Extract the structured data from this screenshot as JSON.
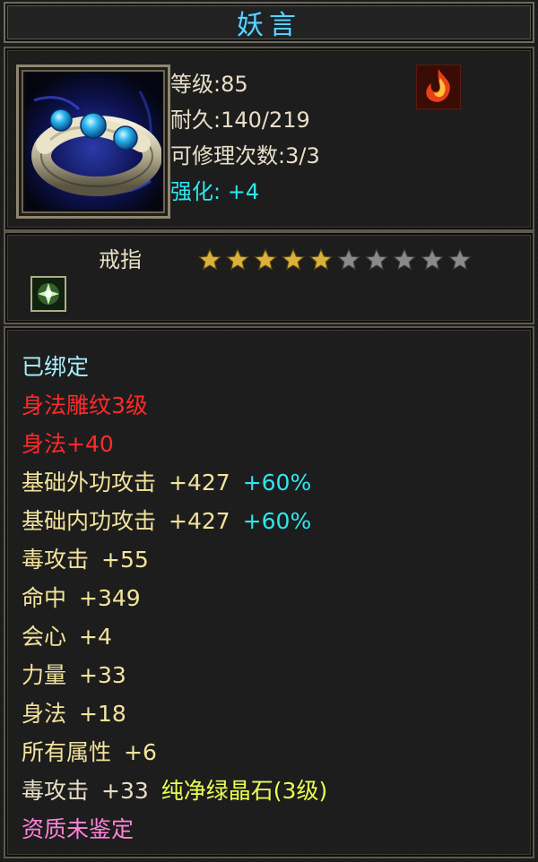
{
  "title": "妖言",
  "item": {
    "level": "等级:85",
    "durability": "耐久:140/219",
    "repair_count": "可修理次数:3/3",
    "enhance_label": "强化:",
    "enhance_value": "+4",
    "type": "戒指",
    "stars_filled": 5,
    "stars_total": 10
  },
  "attributes": {
    "bound": "已绑定",
    "engrave": "身法雕纹3级",
    "engrave_bonus": "身法+40",
    "ext_attack_label": "基础外功攻击",
    "ext_attack_value": "+427",
    "ext_attack_pct": "+60%",
    "int_attack_label": "基础内功攻击",
    "int_attack_value": "+427",
    "int_attack_pct": "+60%",
    "poison_label": "毒攻击",
    "poison_value": "+55",
    "hit_label": "命中",
    "hit_value": "+349",
    "crit_label": "会心",
    "crit_value": "+4",
    "strength_label": "力量",
    "strength_value": "+33",
    "agility_label": "身法",
    "agility_value": "+18",
    "all_attr_label": "所有属性",
    "all_attr_value": "+6",
    "gem_poison_label": "毒攻击",
    "gem_poison_value": "+33",
    "gem_name": "纯净绿晶石(3级)",
    "aptitude": "资质未鉴定"
  },
  "colors": {
    "title": "#5fd2ff",
    "enhance": "#2ee7f0",
    "bound": "#a8f0ff",
    "engrave": "#ff2a2a",
    "stat": "#f3e39b",
    "gem": "#e9ff53",
    "aptitude": "#ff84d8",
    "star_filled": "#d9b23a",
    "star_empty": "#8a8a8a"
  },
  "icons": {
    "item": "ring-icon",
    "set_effect": "fire-icon",
    "gem_slot": "green-gem-icon",
    "star": "star-icon"
  }
}
